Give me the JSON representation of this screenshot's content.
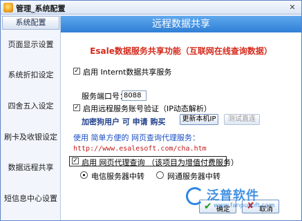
{
  "window": {
    "title": "管理_系统配置",
    "close_glyph": "✕"
  },
  "sidebar": {
    "header": "系统配置",
    "items": [
      {
        "label": "页面显示设置"
      },
      {
        "label": "系统折扣设定"
      },
      {
        "label": "四舍五入设定"
      },
      {
        "label": "刷卡及收银设定"
      },
      {
        "label": "数据远程共享"
      },
      {
        "label": "短信息中心设置"
      }
    ]
  },
  "content": {
    "banner": "远程数据共享",
    "function_title": "Esale数据服务共享功能（互联网在线查询数据）",
    "enable_internet": {
      "label": "启用 Internt数据共享服务",
      "checked": true
    },
    "port": {
      "label": "服务端口号：",
      "value": "8088"
    },
    "enable_verify": {
      "label": "启用远程服务账号验证（IP动态解析）",
      "checked": true
    },
    "subscriber_label": "加密狗用户 可 申请 购买",
    "update_ip_button": "更新本机IP",
    "test_direct_button": "测试直连",
    "intro_text": "使用 简单方便的 网页查询代理服务：",
    "url": "http://www.esalesoft.com/cha.htm",
    "enable_proxy": {
      "label": "启用 网页代理查询 （该项目为增值付费服务）",
      "checked": true
    },
    "radio_telecom": {
      "label": "电信服务器中转",
      "selected": true
    },
    "radio_netcom": {
      "label": "网通服务器中转",
      "selected": false
    },
    "ok_button": "确定",
    "cancel_button": "取消"
  },
  "watermark": {
    "brand": "泛普软件",
    "url": "www.fanpusoft.com"
  },
  "colors": {
    "banner": "#2f7fd6",
    "function_title": "#d42a1c",
    "url": "#c01a1a"
  }
}
